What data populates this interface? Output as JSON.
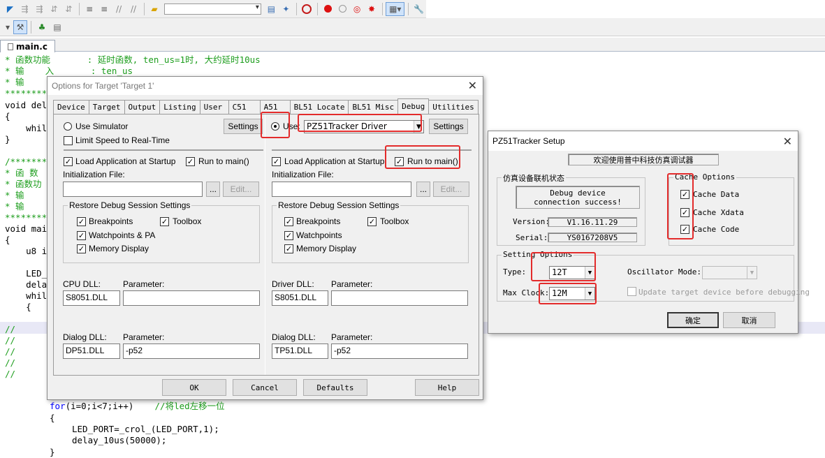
{
  "toolbar": {
    "combo_value": "",
    "icons": [
      "arrow-left-icon",
      "indent-icon",
      "outdent-icon",
      "comment-icon",
      "uncomment-icon",
      "open-folder-icon",
      "find-in-files-icon",
      "debug-icon",
      "breakpoint-icon",
      "enable-breakpoint-icon",
      "disable-breakpoint-icon",
      "kill-breakpoints-icon",
      "window-layout-icon",
      "settings-icon"
    ]
  },
  "tab": {
    "file_name": "main.c"
  },
  "code": {
    "lines": [
      {
        "t": "* 函数功能       : 延时函数, ten_us=1时, 大约延时10us",
        "c": "cm"
      },
      {
        "t": "* 输    入       : ten_us",
        "c": "cm"
      },
      {
        "t": "* 输",
        "c": "cm"
      },
      {
        "t": "*********",
        "c": "cm"
      },
      {
        "t": "void del",
        "c": ""
      },
      {
        "t": "{",
        "c": ""
      },
      {
        "t": "    whil",
        "c": ""
      },
      {
        "t": "}",
        "c": ""
      },
      {
        "t": "",
        "c": ""
      },
      {
        "t": "/*******",
        "c": "cm"
      },
      {
        "t": "* 函 数",
        "c": "cm"
      },
      {
        "t": "* 函数功",
        "c": "cm"
      },
      {
        "t": "* 输",
        "c": "cm"
      },
      {
        "t": "* 输",
        "c": "cm"
      },
      {
        "t": "*********",
        "c": "cm"
      },
      {
        "t": "void mai",
        "c": ""
      },
      {
        "t": "{",
        "c": ""
      },
      {
        "t": "    u8 i",
        "c": ""
      },
      {
        "t": "",
        "c": ""
      },
      {
        "t": "    LED_",
        "c": ""
      },
      {
        "t": "    dela",
        "c": ""
      },
      {
        "t": "    whil",
        "c": ""
      },
      {
        "t": "    {",
        "c": ""
      },
      {
        "t": "",
        "c": ""
      },
      {
        "t": "//",
        "c": "cm"
      },
      {
        "t": "//",
        "c": "cm"
      },
      {
        "t": "//",
        "c": "cm"
      },
      {
        "t": "//",
        "c": "cm"
      },
      {
        "t": "//",
        "c": "cm"
      }
    ],
    "for_line_kw": "for",
    "for_line_rest": "(i=0;i<7;i++)",
    "for_line_comment": "    //将led左移一位",
    "brace_open": "{",
    "led_line": "LED_PORT=_crol_(LED_PORT,1);",
    "delay_line": "delay_10us(50000);",
    "brace_close": "}"
  },
  "options_dialog": {
    "title": "Options for Target 'Target 1'",
    "tabs": [
      "Device",
      "Target",
      "Output",
      "Listing",
      "User",
      "C51",
      "A51",
      "BL51 Locate",
      "BL51 Misc",
      "Debug",
      "Utilities"
    ],
    "active_tab": "Debug",
    "left": {
      "use_simulator": "Use Simulator",
      "settings": "Settings",
      "limit_speed": "Limit Speed to Real-Time",
      "load_app": "Load Application at Startup",
      "run_to_main": "Run to main()",
      "init_file": "Initialization File:",
      "init_file_value": "",
      "browse": "...",
      "edit": "Edit...",
      "restore_group": "Restore Debug Session Settings",
      "breakpoints": "Breakpoints",
      "toolbox": "Toolbox",
      "watchpoints": "Watchpoints & PA",
      "memory_display": "Memory Display",
      "cpu_dll_label": "CPU DLL:",
      "parameter_label": "Parameter:",
      "cpu_dll": "S8051.DLL",
      "cpu_param": "",
      "dialog_dll_label": "Dialog DLL:",
      "dialog_dll": "DP51.DLL",
      "dialog_param": "-p52"
    },
    "right": {
      "use": "Use:",
      "driver": "PZ51Tracker Driver",
      "settings": "Settings",
      "load_app": "Load Application at Startup",
      "run_to_main": "Run to main()",
      "init_file": "Initialization File:",
      "init_file_value": "",
      "browse": "...",
      "edit": "Edit...",
      "restore_group": "Restore Debug Session Settings",
      "breakpoints": "Breakpoints",
      "toolbox": "Toolbox",
      "watchpoints": "Watchpoints",
      "memory_display": "Memory Display",
      "driver_dll_label": "Driver DLL:",
      "parameter_label": "Parameter:",
      "driver_dll": "S8051.DLL",
      "driver_param": "",
      "dialog_dll_label": "Dialog DLL:",
      "dialog_dll": "TP51.DLL",
      "dialog_param": "-p52"
    },
    "buttons": {
      "ok": "OK",
      "cancel": "Cancel",
      "defaults": "Defaults",
      "help": "Help"
    }
  },
  "setup_dialog": {
    "title": "PZ51Tracker Setup",
    "welcome": "欢迎使用普中科技仿真调试器",
    "conn_group": "仿真设备联机状态",
    "conn_status": "Debug device connection success!",
    "version_label": "Version:",
    "version": "V1.16.11.29",
    "serial_label": "Serial:",
    "serial": "YS0167208V5",
    "cache_group": "Cache Options",
    "cache_data": "Cache Data",
    "cache_xdata": "Cache Xdata",
    "cache_code": "Cache Code",
    "setting_group": "Setting Options",
    "type_label": "Type:",
    "type_value": "12T",
    "osc_label": "Oscillator Mode:",
    "osc_value": "",
    "maxclock_label": "Max Clock:",
    "maxclock_value": "12M",
    "update_label": "Update target device before debugging",
    "ok": "确定",
    "cancel": "取消"
  },
  "colors": {
    "annotation": "#e32b2b",
    "comment": "#1c9d1c",
    "keyword": "#0000ff"
  }
}
